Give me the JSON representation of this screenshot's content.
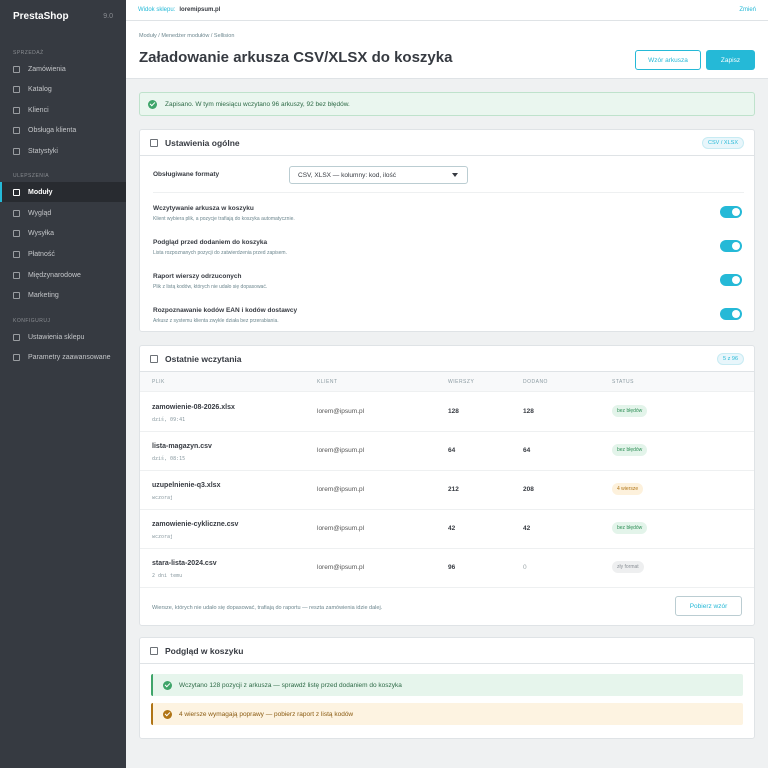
{
  "sidebar": {
    "brand": "PrestaShop",
    "version": "9.0",
    "sections": [
      {
        "title": "SPRZEDAŻ",
        "items": [
          "Zamówienia",
          "Katalog",
          "Klienci",
          "Obsługa klienta",
          "Statystyki"
        ]
      },
      {
        "title": "ULEPSZENIA",
        "items": [
          "Moduły",
          "Wygląd",
          "Wysyłka",
          "Płatność",
          "Międzynarodowe",
          "Marketing"
        ]
      },
      {
        "title": "KONFIGURUJ",
        "items": [
          "Ustawienia sklepu",
          "Parametry zaawansowane"
        ]
      }
    ],
    "active": "Moduły"
  },
  "topbar": {
    "label": "Widok sklepu:",
    "url": "loremipsum.pl",
    "change": "Zmień"
  },
  "header": {
    "breadcrumb": "Moduły  /  Menedżer modułów  /  Sellision",
    "title": "Załadowanie arkusza CSV/XLSX do koszyka",
    "btn_template": "Wzór arkusza",
    "btn_save": "Zapisz"
  },
  "alert": "Zapisano. W tym miesiącu wczytano 96 arkuszy, 92 bez błędów.",
  "general": {
    "title": "Ustawienia ogólne",
    "badge": "CSV / XLSX",
    "formats_label": "Obsługiwane formaty",
    "formats_value": "CSV, XLSX — kolumny: kod, ilość",
    "settings": [
      {
        "label": "Wczytywanie arkusza w koszyku",
        "desc": "Klient wybiera plik, a pozycje trafiają do koszyka automatycznie.",
        "on": true
      },
      {
        "label": "Podgląd przed dodaniem do koszyka",
        "desc": "Lista rozpoznanych pozycji do zatwierdzenia przed zapisem.",
        "on": true
      },
      {
        "label": "Raport wierszy odrzuconych",
        "desc": "Plik z listą kodów, których nie udało się dopasować.",
        "on": true
      },
      {
        "label": "Rozpoznawanie kodów EAN i kodów dostawcy",
        "desc": "Arkusz z systemu klienta zwykle działa bez przerabiania.",
        "on": true
      }
    ]
  },
  "recent": {
    "title": "Ostatnie wczytania",
    "badge": "5 z 96",
    "columns": [
      "PLIK",
      "KLIENT",
      "WIERSZY",
      "DODANO",
      "STATUS"
    ],
    "rows": [
      {
        "file": "zamowienie-08-2026.xlsx",
        "date": "dziś, 09:41",
        "client": "lorem@ipsum.pl",
        "rows": "128",
        "added": "128",
        "status": "bez błędów",
        "kind": "ok"
      },
      {
        "file": "lista-magazyn.csv",
        "date": "dziś, 08:15",
        "client": "lorem@ipsum.pl",
        "rows": "64",
        "added": "64",
        "status": "bez błędów",
        "kind": "ok"
      },
      {
        "file": "uzupelnienie-q3.xlsx",
        "date": "wczoraj",
        "client": "lorem@ipsum.pl",
        "rows": "212",
        "added": "208",
        "status": "4 wiersze",
        "kind": "warn"
      },
      {
        "file": "zamowienie-cykliczne.csv",
        "date": "wczoraj",
        "client": "lorem@ipsum.pl",
        "rows": "42",
        "added": "42",
        "status": "bez błędów",
        "kind": "ok"
      },
      {
        "file": "stara-lista-2024.csv",
        "date": "2 dni temu",
        "client": "lorem@ipsum.pl",
        "rows": "96",
        "added": "0",
        "status": "zły format",
        "kind": "bad"
      }
    ],
    "footer_text": "Wiersze, których nie udało się dopasować, trafiają do raportu — reszta zamówienia idzie dalej.",
    "footer_btn": "Pobierz wzór"
  },
  "preview": {
    "title": "Podgląd w koszyku",
    "ok_msg": "Wczytano 128 pozycji z arkusza — sprawdź listę przed dodaniem do koszyka",
    "warn_msg": "4 wiersze wymagają poprawy — pobierz raport z listą kodów"
  },
  "colors": {
    "accent": "#25b9d7",
    "sidebar": "#363a41",
    "success": "#3fa56a",
    "warning": "#b07415"
  }
}
